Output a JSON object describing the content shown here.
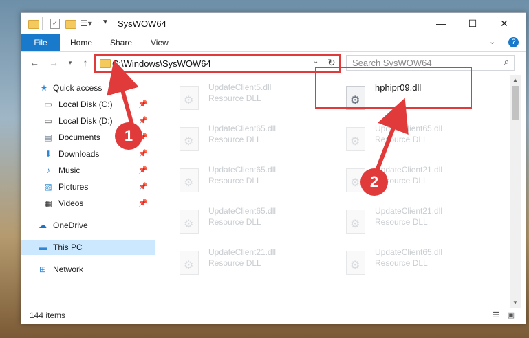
{
  "window": {
    "title": "SysWOW64",
    "controls": {
      "minimize": "—",
      "maximize": "☐",
      "close": "✕"
    }
  },
  "ribbon": {
    "file": "File",
    "home": "Home",
    "share": "Share",
    "view": "View",
    "help_icon": "?"
  },
  "nav": {
    "address": "C:\\Windows\\SysWOW64",
    "search_placeholder": "Search SysWOW64"
  },
  "sidebar": {
    "items": [
      {
        "label": "Quick access",
        "icon": "star-icon"
      },
      {
        "label": "Local Disk (C:)",
        "icon": "drive-icon"
      },
      {
        "label": "Local Disk (D:)",
        "icon": "drive-icon"
      },
      {
        "label": "Documents",
        "icon": "documents-icon"
      },
      {
        "label": "Downloads",
        "icon": "download-icon"
      },
      {
        "label": "Music",
        "icon": "music-icon"
      },
      {
        "label": "Pictures",
        "icon": "pictures-icon"
      },
      {
        "label": "Videos",
        "icon": "videos-icon"
      },
      {
        "label": "OneDrive",
        "icon": "cloud-icon"
      },
      {
        "label": "This PC",
        "icon": "computer-icon"
      },
      {
        "label": "Network",
        "icon": "network-icon"
      }
    ]
  },
  "files": {
    "highlighted": {
      "name": "hphipr09.dll"
    },
    "left": [
      {
        "name": "UpdateClient5.dll",
        "type": "Resource DLL"
      },
      {
        "name": "UpdateClient65.dll",
        "type": "Resource DLL"
      },
      {
        "name": "UpdateClient65.dll",
        "type": "Resource DLL"
      },
      {
        "name": "UpdateClient65.dll",
        "type": "Resource DLL"
      },
      {
        "name": "UpdateClient21.dll",
        "type": "Resource DLL"
      }
    ],
    "right": [
      {
        "name": "UpdateClient65.dll",
        "type": "Resource DLL"
      },
      {
        "name": "UpdateClient21.dll",
        "type": "Resource DLL"
      },
      {
        "name": "UpdateClient21.dll",
        "type": "Resource DLL"
      },
      {
        "name": "UpdateClient65.dll",
        "type": "Resource DLL"
      }
    ]
  },
  "status": {
    "items": "144 items"
  },
  "annotations": {
    "marker1": "1",
    "marker2": "2",
    "color": "#e03a3a"
  }
}
